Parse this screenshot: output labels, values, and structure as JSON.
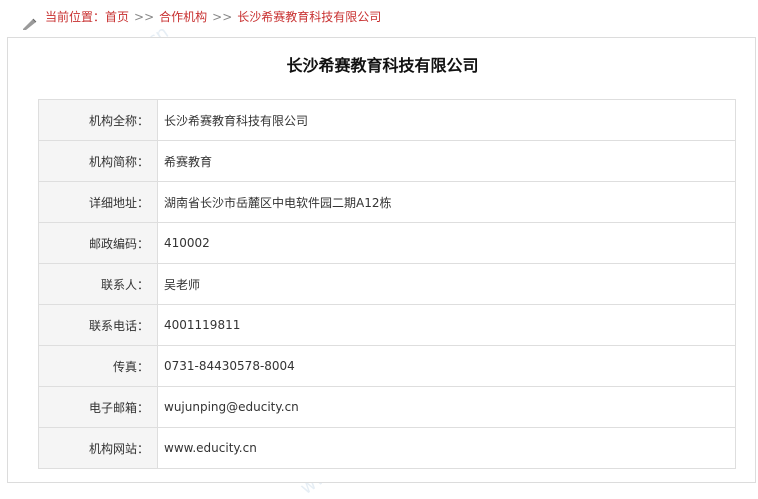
{
  "breadcrumb": {
    "prefix": "当前位置：",
    "home": "首页",
    "sep1": ">>",
    "section": "合作机构",
    "sep2": ">>",
    "current": "长沙希赛教育科技有限公司"
  },
  "page": {
    "title": "长沙希赛教育科技有限公司"
  },
  "fields": [
    {
      "label": "机构全称：",
      "value": "长沙希赛教育科技有限公司"
    },
    {
      "label": "机构简称：",
      "value": "希赛教育"
    },
    {
      "label": "详细地址：",
      "value": "湖南省长沙市岳麓区中电软件园二期A12栋"
    },
    {
      "label": "邮政编码：",
      "value": "410002"
    },
    {
      "label": "联系人：",
      "value": "吴老师"
    },
    {
      "label": "联系电话：",
      "value": "4001119811"
    },
    {
      "label": "传真：",
      "value": "0731-84430578-8004"
    },
    {
      "label": "电子邮箱：",
      "value": "wujunping@educity.cn"
    },
    {
      "label": "机构网站：",
      "value": "www.educity.cn"
    }
  ],
  "watermark": {
    "brand": "希赛",
    "domain": "www.educity.cn"
  }
}
